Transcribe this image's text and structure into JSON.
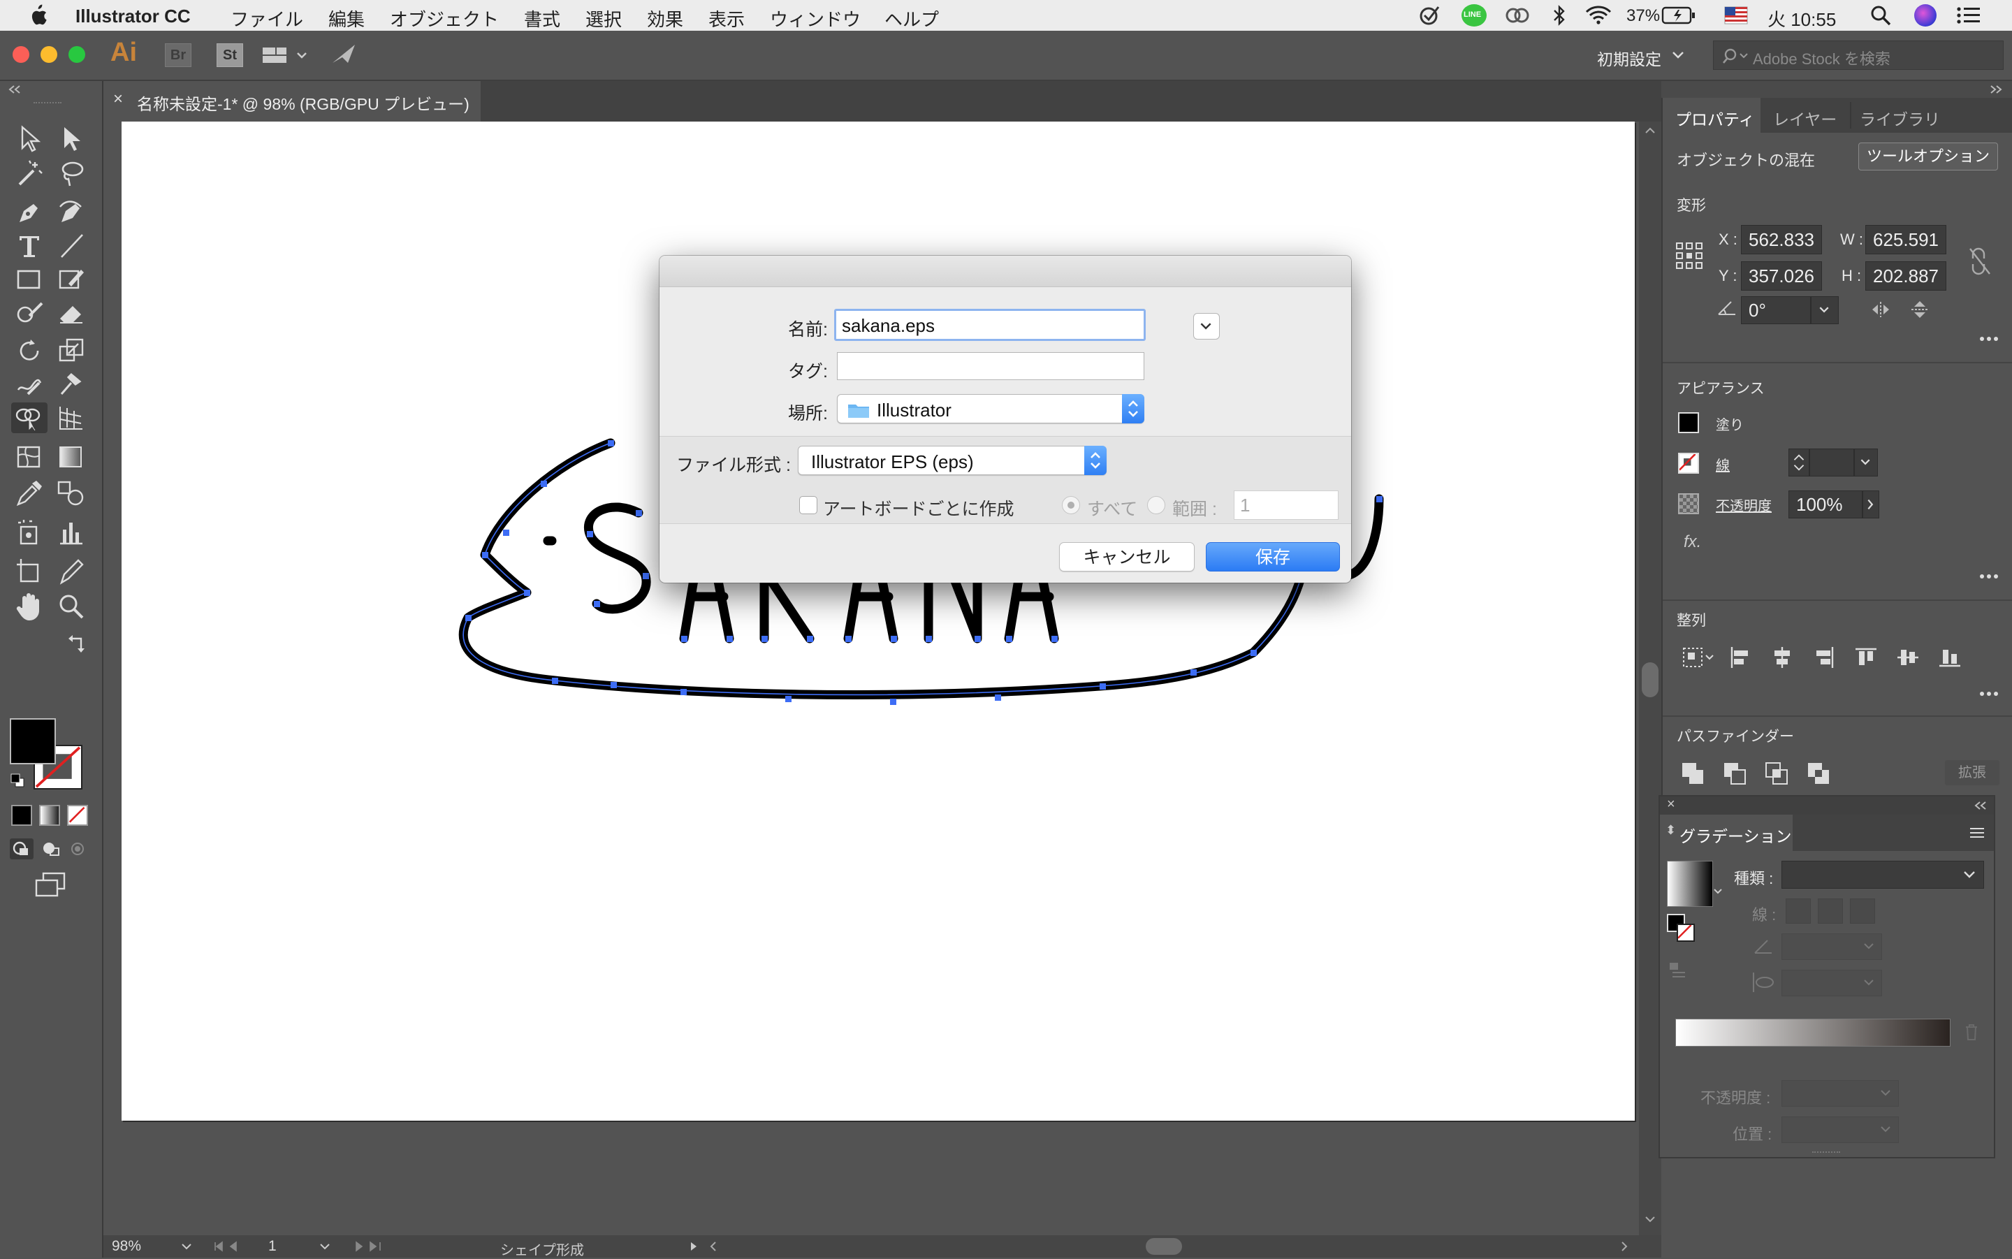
{
  "menubar": {
    "app_name": "Illustrator CC",
    "menus": [
      "ファイル",
      "編集",
      "オブジェクト",
      "書式",
      "選択",
      "効果",
      "表示",
      "ウィンドウ",
      "ヘルプ"
    ],
    "battery": "37%",
    "clock": "火 10:55",
    "line_label": "LINE"
  },
  "appbar": {
    "ai_logo": "Ai",
    "br_logo": "Br",
    "st_logo": "St",
    "workspace": "初期設定",
    "stock_search_placeholder": "Adobe Stock を検索"
  },
  "document": {
    "tab_title": "名称未設定-1* @ 98% (RGB/GPU プレビュー)",
    "close_glyph": "×",
    "artwork_text": "SAKANA"
  },
  "status": {
    "zoom": "98%",
    "page": "1",
    "tool_name": "シェイプ形成"
  },
  "properties_panel": {
    "tabs": [
      "プロパティ",
      "レイヤー",
      "ライブラリ"
    ],
    "selection": "オブジェクトの混在",
    "tool_options_button": "ツールオプション",
    "transform": {
      "title": "変形",
      "x_label": "X :",
      "x": "562.833",
      "y_label": "Y :",
      "y": "357.026",
      "w_label": "W :",
      "w": "625.591",
      "h_label": "H :",
      "h": "202.887",
      "angle": "0°"
    },
    "appearance": {
      "title": "アピアランス",
      "fill_label": "塗り",
      "stroke_label": "線",
      "opacity_label": "不透明度",
      "opacity": "100%",
      "fx": "fx."
    },
    "align_title": "整列",
    "pathfinder": {
      "title": "パスファインダー",
      "expand_button": "拡張"
    }
  },
  "gradient_panel": {
    "title": "グラデーション",
    "type_label": "種類 :",
    "stroke_label": "線 :",
    "opacity_label": "不透明度 :",
    "position_label": "位置 :"
  },
  "save_dialog": {
    "name_label": "名前:",
    "name_value": "sakana.eps",
    "tags_label": "タグ:",
    "where_label": "場所:",
    "where_value": "Illustrator",
    "format_label": "ファイル形式 :",
    "format_value": "Illustrator EPS (eps)",
    "per_artboard_label": "アートボードごとに作成",
    "all_label": "すべて",
    "range_label": "範囲 :",
    "range_value": "1",
    "cancel_button": "キャンセル",
    "save_button": "保存"
  },
  "colors": {
    "ui_dark": "#535353",
    "accent_blue": "#3a86f5",
    "anchor_blue": "#3d6df5",
    "ai_orange": "#c8843a"
  }
}
